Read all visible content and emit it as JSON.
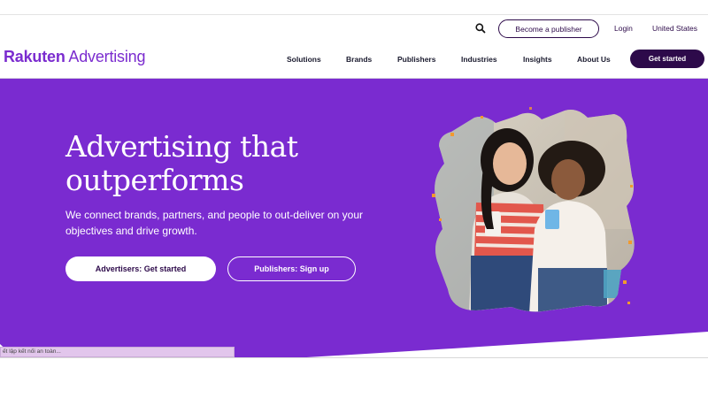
{
  "header": {
    "utility": {
      "search_icon": "search-icon",
      "become_publisher": "Become a publisher",
      "login": "Login",
      "country": "United States"
    },
    "logo": {
      "bold": "Rakuten",
      "light": " Advertising"
    },
    "nav": {
      "solutions": "Solutions",
      "brands": "Brands",
      "publishers": "Publishers",
      "industries": "Industries",
      "insights": "Insights",
      "about_us": "About Us"
    },
    "get_started": "Get started"
  },
  "hero": {
    "title_line1": "Advertising that",
    "title_line2": "outperforms",
    "subtitle": "We connect brands, partners, and people to out-deliver on your objectives and drive growth.",
    "cta_advertisers": "Advertisers: Get started",
    "cta_publishers": "Publishers: Sign up",
    "image_alt": "Two smiling women looking at a phone"
  },
  "browser_status": "ết lập kết nối an toàn...",
  "colors": {
    "brand_purple": "#7a2bd0",
    "dark_purple": "#2d0a4a",
    "accent_orange": "#f29a2e"
  }
}
